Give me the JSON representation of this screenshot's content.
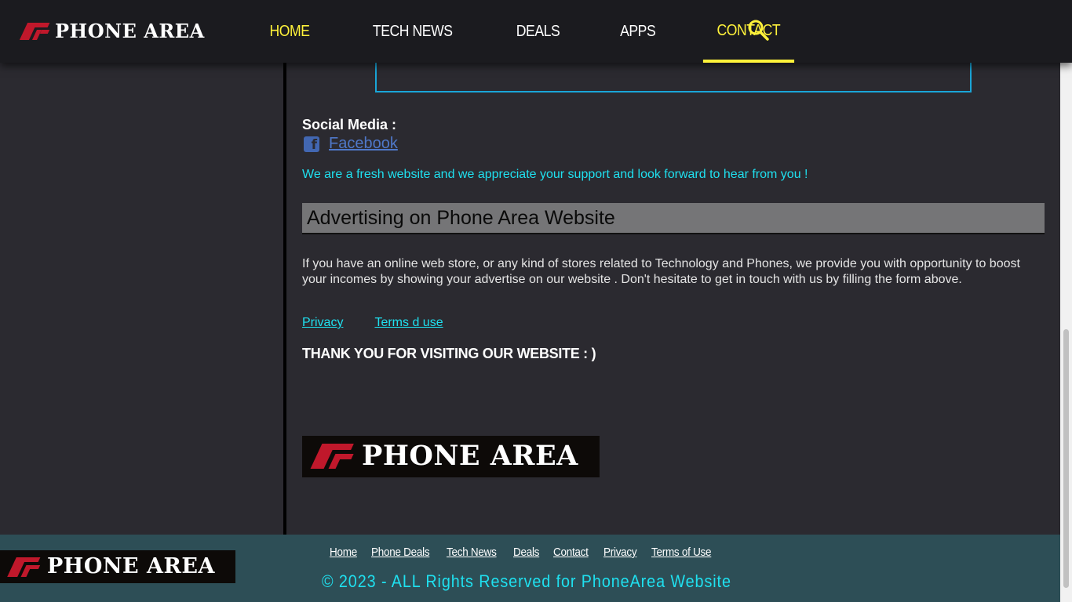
{
  "header": {
    "logo_text": "PHONE AREA",
    "nav": [
      {
        "label": "HOME"
      },
      {
        "label": "TECH NEWS"
      },
      {
        "label": "DEALS"
      },
      {
        "label": "APPS"
      },
      {
        "label": "CONTACT"
      }
    ],
    "accent_color": "#fff23a"
  },
  "content": {
    "social_title": "Social Media :",
    "facebook_label": "Facebook",
    "fresh_message": "We are a fresh website and we appreciate your support and look forward to hear from you !",
    "ad_heading": "Advertising on Phone Area Website",
    "ad_text": "If you have an online web store, or any kind of stores related to Technology and Phones, we provide you with opportunity to boost your incomes by showing your advertise on our website . Don't hesitate to get in touch with us by filling the form above.",
    "links": {
      "privacy": "Privacy",
      "terms": "Terms d use"
    },
    "thanks": "THANK YOU FOR VISITING OUR WEBSITE : )",
    "logo_text": "PHONE AREA"
  },
  "footer": {
    "logo_text": "PHONE AREA",
    "links": [
      "Home",
      "Phone Deals",
      "Tech News",
      "Deals",
      "Contact",
      "Privacy",
      "Terms of Use"
    ],
    "copyright": "© 2023 - ALL Rights Reserved for PhoneArea Website"
  }
}
